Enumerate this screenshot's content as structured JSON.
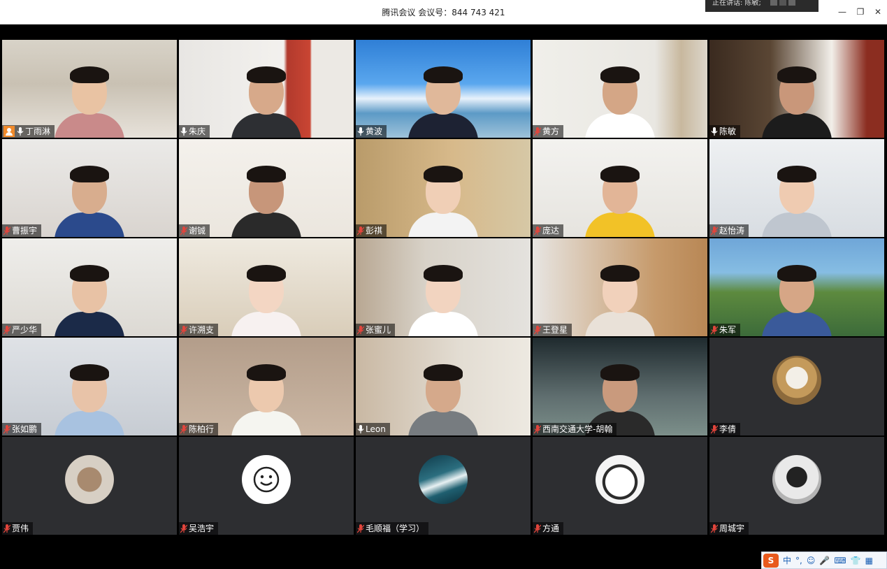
{
  "window": {
    "title": "腾讯会议 会议号：844 743 421",
    "speaking_label": "正在讲话: 陈敏;",
    "controls": [
      "minimize-icon",
      "restore-icon",
      "close-icon"
    ]
  },
  "colors": {
    "muted_mic": "#e2453c",
    "active_mic": "#ffffff",
    "host_badge": "#f08a2a",
    "tile_empty_bg": "#2d2e31",
    "active_speaker_border": "#3bb54a"
  },
  "participants": [
    {
      "name": "丁雨淋",
      "host": true,
      "mic": "on"
    },
    {
      "name": "朱庆",
      "mic": "on"
    },
    {
      "name": "黄波",
      "mic": "on"
    },
    {
      "name": "黄方",
      "mic": "muted"
    },
    {
      "name": "陈敏",
      "mic": "on",
      "speaking": true
    },
    {
      "name": "曹振宇",
      "mic": "muted"
    },
    {
      "name": "谢铖",
      "mic": "muted"
    },
    {
      "name": "彭祺",
      "mic": "muted"
    },
    {
      "name": "庞达",
      "mic": "muted"
    },
    {
      "name": "赵怡涛",
      "mic": "muted"
    },
    {
      "name": "严少华",
      "mic": "muted"
    },
    {
      "name": "许溯支",
      "mic": "muted"
    },
    {
      "name": "张蜜儿",
      "mic": "muted"
    },
    {
      "name": "王登星",
      "mic": "muted"
    },
    {
      "name": "朱军",
      "mic": "muted"
    },
    {
      "name": "张如鹏",
      "mic": "muted"
    },
    {
      "name": "陈柏行",
      "mic": "muted"
    },
    {
      "name": "Leon",
      "mic": "on"
    },
    {
      "name": "西南交通大学-胡翰",
      "mic": "muted"
    },
    {
      "name": "李倩",
      "mic": "muted",
      "video": false,
      "avatar": "sheep-avatar"
    },
    {
      "name": "贾伟",
      "mic": "muted",
      "video": false,
      "avatar": "photo-avatar"
    },
    {
      "name": "吴浩宇",
      "mic": "muted",
      "video": false,
      "avatar": "smiley-avatar"
    },
    {
      "name": "毛顺福（学习）",
      "mic": "muted",
      "video": false,
      "avatar": "ocean-avatar"
    },
    {
      "name": "方通",
      "mic": "muted",
      "video": false,
      "avatar": "cartoon-avatar"
    },
    {
      "name": "周城宇",
      "mic": "muted",
      "video": false,
      "avatar": "person-avatar"
    }
  ],
  "ime": {
    "lang": "中",
    "items": [
      "°,",
      "☺",
      "🎤",
      "⌨",
      "👕",
      "▦"
    ]
  }
}
